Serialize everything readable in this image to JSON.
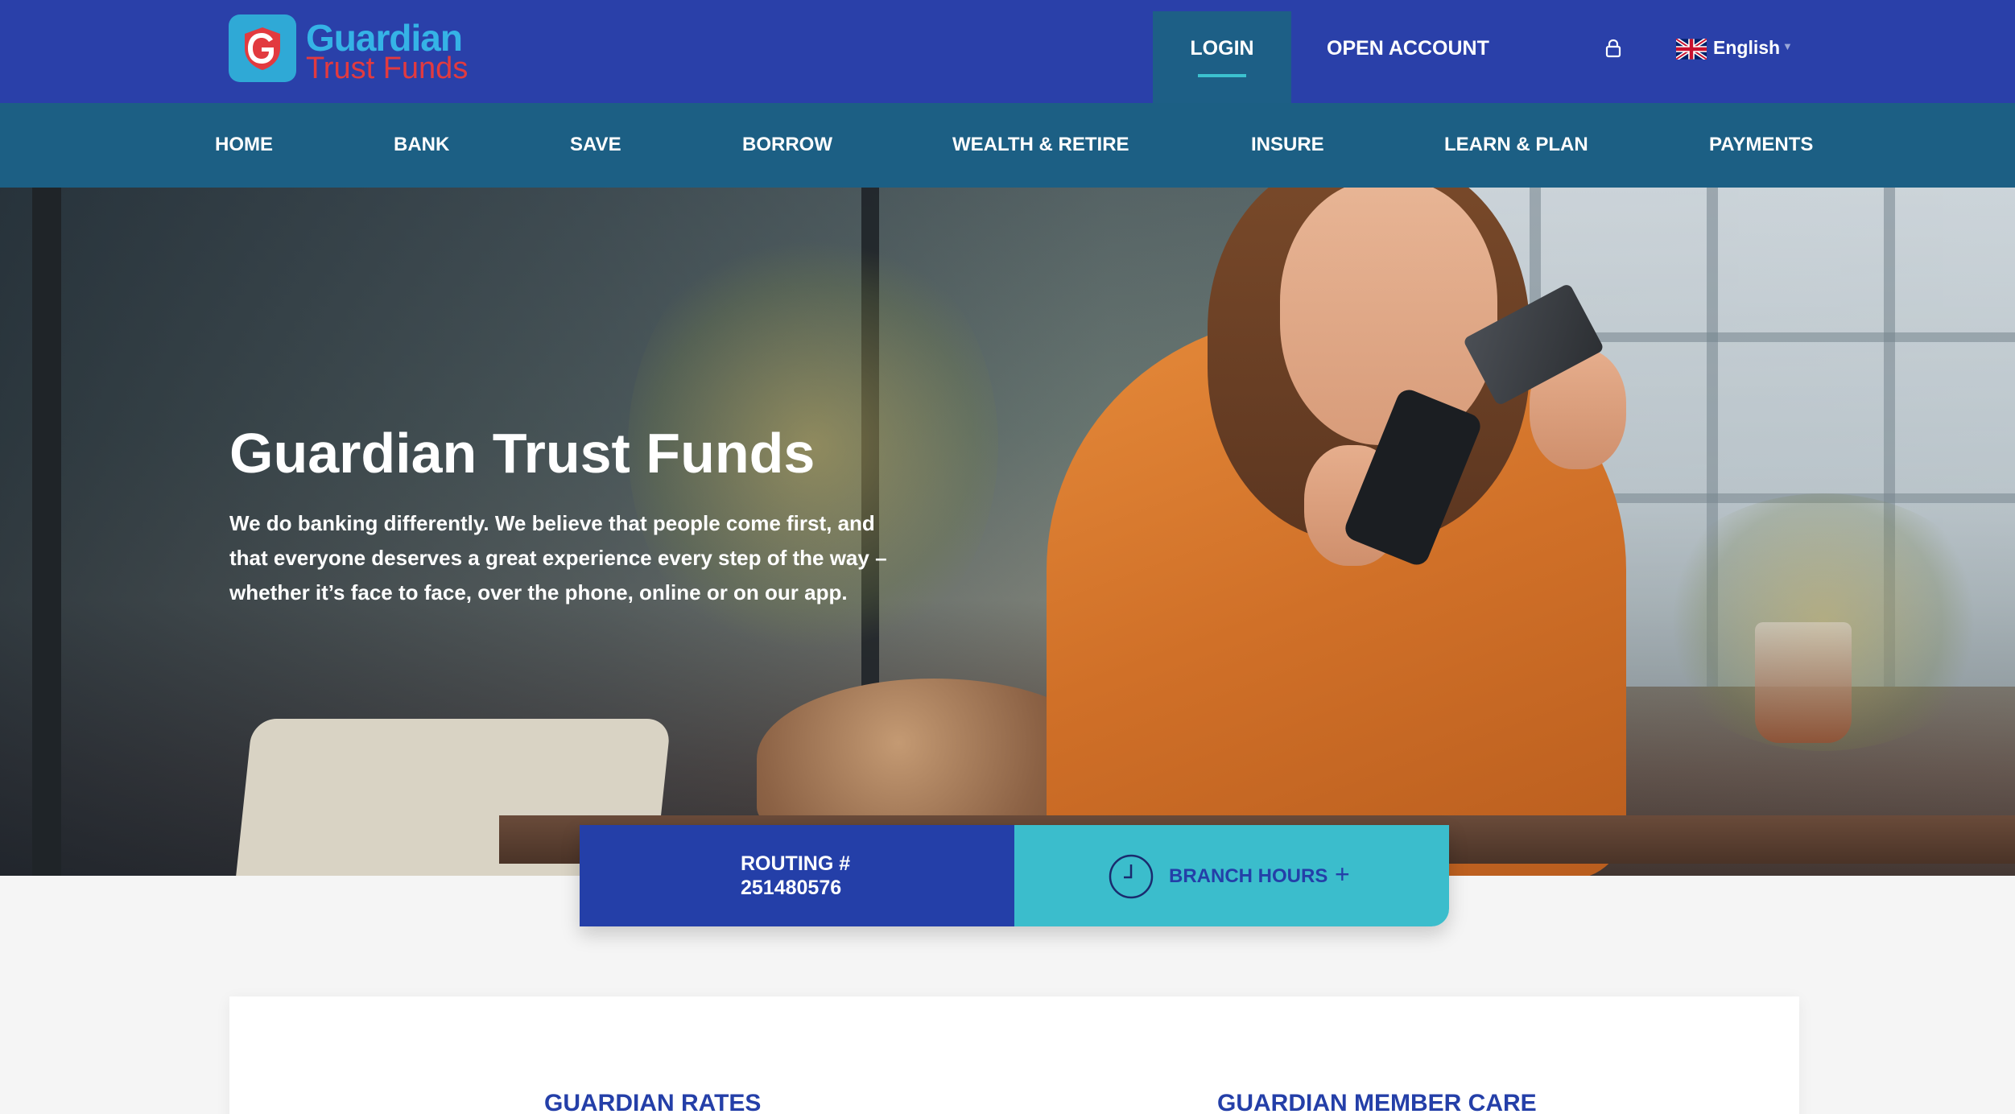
{
  "brand": {
    "name_line1": "Guardian",
    "name_line2": "Trust Funds",
    "colors": {
      "primary": "#2a40a9",
      "nav": "#1c5f84",
      "accent": "#3bbdcc",
      "logo_blue": "#35b3e6",
      "logo_red": "#e23a3f"
    }
  },
  "topbar": {
    "login_label": "LOGIN",
    "open_account_label": "OPEN ACCOUNT",
    "lock_icon": "lock-icon",
    "language": {
      "label": "English",
      "flag_icon": "uk-flag-icon"
    }
  },
  "nav": {
    "items": [
      {
        "label": "HOME"
      },
      {
        "label": "BANK"
      },
      {
        "label": "SAVE"
      },
      {
        "label": "BORROW"
      },
      {
        "label": "WEALTH & RETIRE"
      },
      {
        "label": "INSURE"
      },
      {
        "label": "LEARN & PLAN"
      },
      {
        "label": "PAYMENTS"
      }
    ]
  },
  "hero": {
    "title": "Guardian Trust Funds",
    "line1": "We do banking differently. We believe that people come first, and",
    "line2": "that everyone deserves a great experience every step of the way –",
    "line3": "whether it’s face to face, over the phone, online or on our app."
  },
  "info": {
    "routing_label": "ROUTING #",
    "routing_number": "251480576",
    "branch_hours_label": "BRANCH HOURS",
    "branch_hours_plus": "+",
    "clock_icon": "clock-icon"
  },
  "lower": {
    "rates_title": "GUARDIAN RATES",
    "member_care_title": "GUARDIAN MEMBER CARE"
  }
}
